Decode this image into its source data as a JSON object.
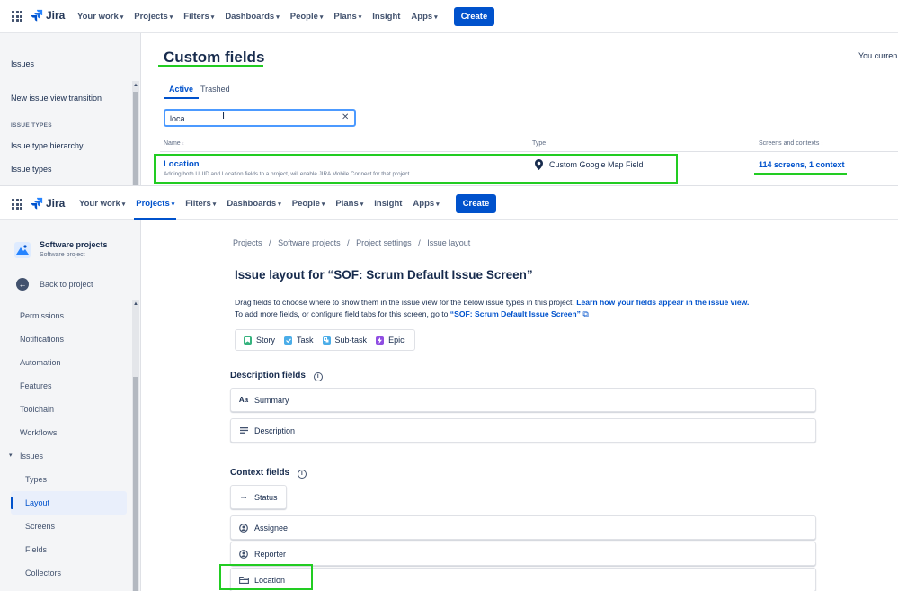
{
  "nav": {
    "logo": "Jira",
    "items": [
      "Your work",
      "Projects",
      "Filters",
      "Dashboards",
      "People",
      "Plans",
      "Insight",
      "Apps"
    ],
    "create": "Create"
  },
  "top": {
    "sidebar": {
      "issues": "Issues",
      "new_view": "New issue view transition",
      "issue_types_header": "ISSUE TYPES",
      "type_hierarchy": "Issue type hierarchy",
      "issue_types": "Issue types"
    },
    "title": "Custom fields",
    "you_current": "You curren",
    "tabs": [
      "Active",
      "Trashed"
    ],
    "search_value": "loca",
    "columns": {
      "name": "Name",
      "type": "Type",
      "screens": "Screens and contexts"
    },
    "row": {
      "name": "Location",
      "description": "Adding both UUID and Location fields to a project, will enable JIRA Mobile Connect for that project.",
      "type": "Custom Google Map Field",
      "screens": "114 screens, 1 context"
    }
  },
  "bottom": {
    "project": {
      "name": "Software projects",
      "sub": "Software project"
    },
    "back": "Back to project",
    "sidebar_items": [
      "Permissions",
      "Notifications",
      "Automation",
      "Features",
      "Toolchain",
      "Workflows"
    ],
    "issues_group": "Issues",
    "issues_sub": [
      "Types",
      "Layout",
      "Screens",
      "Fields",
      "Collectors"
    ],
    "breadcrumbs": [
      "Projects",
      "Software projects",
      "Project settings",
      "Issue layout"
    ],
    "title": "Issue layout for “SOF: Scrum Default Issue Screen”",
    "desc1": "Drag fields to choose where to show them in the issue view for the below issue types in this project.",
    "desc1_link": "Learn how your fields appear in the issue view.",
    "desc2": "To add more fields, or configure field tabs for this screen, go to",
    "desc2_link": "“SOF: Scrum Default Issue Screen”",
    "issue_types": [
      "Story",
      "Task",
      "Sub-task",
      "Epic"
    ],
    "issue_type_colors": [
      "#36b37e",
      "#4bade8",
      "#4bade8",
      "#904ee2"
    ],
    "description_fields_label": "Description fields",
    "description_fields": [
      "Summary",
      "Description"
    ],
    "context_fields_label": "Context fields",
    "context_fields": [
      "Status",
      "Assignee",
      "Reporter",
      "Location"
    ]
  },
  "colors": {
    "accent": "#0052cc",
    "highlight": "#22cc22"
  }
}
